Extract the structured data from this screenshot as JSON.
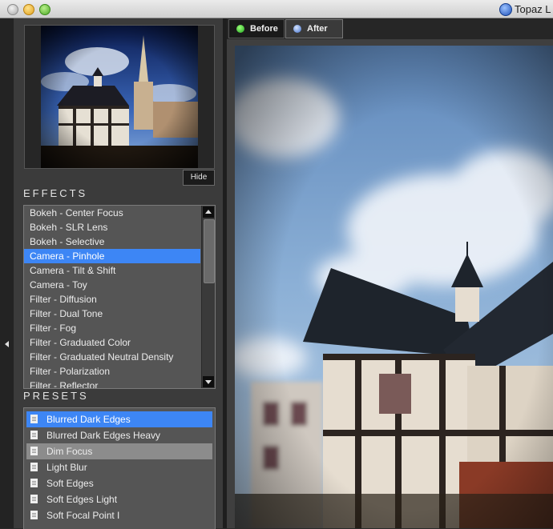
{
  "window": {
    "title": "Topaz L"
  },
  "preview": {
    "hide_label": "Hide"
  },
  "effects": {
    "title": "EFFECTS",
    "items": [
      "Bokeh - Center Focus",
      "Bokeh - SLR Lens",
      "Bokeh - Selective",
      "Camera - Pinhole",
      "Camera - Tilt & Shift",
      "Camera - Toy",
      "Filter - Diffusion",
      "Filter - Dual Tone",
      "Filter - Fog",
      "Filter - Graduated Color",
      "Filter - Graduated Neutral Density",
      "Filter - Polarization",
      "Filter - Reflector"
    ],
    "selected_index": 3
  },
  "presets": {
    "title": "PRESETS",
    "items": [
      "Blurred Dark Edges",
      "Blurred Dark Edges Heavy",
      "Dim Focus",
      "Light Blur",
      "Soft Edges",
      "Soft Edges Light",
      "Soft Focal Point I"
    ],
    "selected_index": 0,
    "highlighted_index": 2
  },
  "tabs": {
    "before_label": "Before",
    "after_label": "After",
    "active": "After"
  },
  "colors": {
    "selection": "#3d86f5",
    "panel": "#3b3b3b",
    "list": "#555555"
  }
}
